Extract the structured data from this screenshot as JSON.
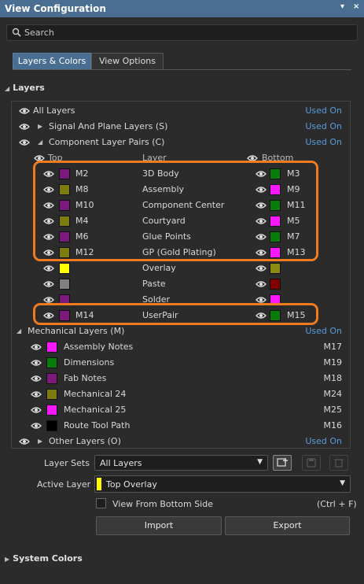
{
  "window": {
    "title": "View Configuration",
    "pin": "▾",
    "close": "×"
  },
  "search": {
    "placeholder": "Search",
    "value": ""
  },
  "tabs": [
    {
      "label": "Layers & Colors",
      "active": true
    },
    {
      "label": "View Options",
      "active": false
    }
  ],
  "layers_section": {
    "title": "Layers"
  },
  "groups": {
    "all": {
      "label": "All Layers",
      "used_on": "Used On"
    },
    "signal": {
      "label": "Signal And Plane Layers (S)",
      "used_on": "Used On"
    },
    "component": {
      "label": "Component Layer Pairs (C)",
      "used_on": "Used On"
    },
    "mechanical": {
      "label": "Mechanical Layers (M)",
      "used_on": "Used On"
    },
    "other": {
      "label": "Other Layers (O)",
      "used_on": "Used On"
    }
  },
  "pair_columns": {
    "top": "Top",
    "layer": "Layer",
    "bottom": "Bottom"
  },
  "component_pairs": [
    {
      "top_code": "M2",
      "top_color": "#7b1a7b",
      "layer": "3D Body",
      "bottom_code": "M3",
      "bottom_color": "#0a7a0a"
    },
    {
      "top_code": "M8",
      "top_color": "#7d7a10",
      "layer": "Assembly",
      "bottom_code": "M9",
      "bottom_color": "#ff18ff"
    },
    {
      "top_code": "M10",
      "top_color": "#7b1a7b",
      "layer": "Component Center",
      "bottom_code": "M11",
      "bottom_color": "#0a7a0a"
    },
    {
      "top_code": "M4",
      "top_color": "#7d7a10",
      "layer": "Courtyard",
      "bottom_code": "M5",
      "bottom_color": "#ff18ff"
    },
    {
      "top_code": "M6",
      "top_color": "#7b1a7b",
      "layer": "Glue Points",
      "bottom_code": "M7",
      "bottom_color": "#0a7a0a"
    },
    {
      "top_code": "M12",
      "top_color": "#7d7a10",
      "layer": "GP (Gold Plating)",
      "bottom_code": "M13",
      "bottom_color": "#ff18ff"
    },
    {
      "top_code": "",
      "top_color": "#ffff00",
      "layer": "Overlay",
      "bottom_code": "",
      "bottom_color": "#8a8a10"
    },
    {
      "top_code": "",
      "top_color": "#808080",
      "layer": "Paste",
      "bottom_code": "",
      "bottom_color": "#800000"
    },
    {
      "top_code": "",
      "top_color": "#7b1a7b",
      "layer": "Solder",
      "bottom_code": "",
      "bottom_color": "#ff18ff"
    },
    {
      "top_code": "M14",
      "top_color": "#7b1a7b",
      "layer": "UserPair",
      "bottom_code": "M15",
      "bottom_color": "#0a7a0a"
    }
  ],
  "mechanical_layers": [
    {
      "name": "Assembly Notes",
      "color": "#ff18ff",
      "code": "M17"
    },
    {
      "name": "Dimensions",
      "color": "#0a7a0a",
      "code": "M19"
    },
    {
      "name": "Fab Notes",
      "color": "#7b1a7b",
      "code": "M18"
    },
    {
      "name": "Mechanical 24",
      "color": "#7d7a10",
      "code": "M24"
    },
    {
      "name": "Mechanical 25",
      "color": "#ff18ff",
      "code": "M25"
    },
    {
      "name": "Route Tool Path",
      "color": "#000000",
      "code": "M16"
    }
  ],
  "layer_sets": {
    "label": "Layer Sets",
    "value": "All Layers"
  },
  "active_layer": {
    "label": "Active Layer",
    "value": "Top Overlay",
    "color": "#ffff00"
  },
  "view_from_bottom": {
    "label": "View From Bottom Side",
    "shortcut": "(Ctrl + F)",
    "checked": false
  },
  "buttons": {
    "import": "Import",
    "export": "Export"
  },
  "system_colors": {
    "title": "System Colors"
  }
}
